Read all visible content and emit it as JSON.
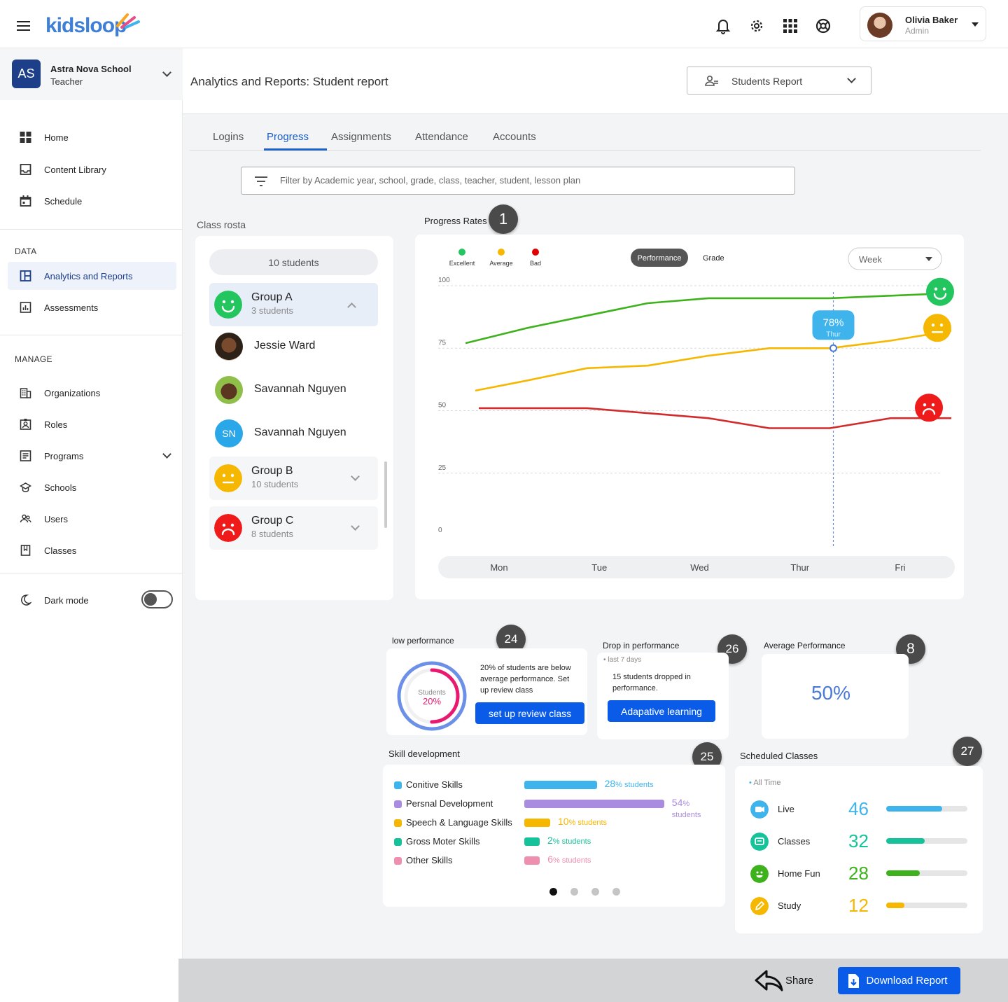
{
  "app": {
    "logo": "kidsloop"
  },
  "user": {
    "name": "Olivia Baker",
    "role": "Admin"
  },
  "school": {
    "initials": "AS",
    "name": "Astra Nova School",
    "role": "Teacher"
  },
  "sidebar": {
    "main_items": [
      {
        "label": "Home",
        "icon": "grid-icon"
      },
      {
        "label": "Content Library",
        "icon": "inbox-icon"
      },
      {
        "label": "Schedule",
        "icon": "calendar-icon"
      }
    ],
    "data_title": "DATA",
    "data_items": [
      {
        "label": "Analytics and Reports",
        "icon": "analytics-icon"
      },
      {
        "label": "Assessments",
        "icon": "bar-chart-icon"
      }
    ],
    "manage_title": "MANAGE",
    "manage_items": [
      {
        "label": "Organizations",
        "icon": "building-icon"
      },
      {
        "label": "Roles",
        "icon": "id-badge-icon"
      },
      {
        "label": "Programs",
        "icon": "list-icon"
      },
      {
        "label": "Schools",
        "icon": "school-icon"
      },
      {
        "label": "Users",
        "icon": "users-icon"
      },
      {
        "label": "Classes",
        "icon": "book-icon"
      }
    ],
    "dark_mode": "Dark mode"
  },
  "header": {
    "title": "Analytics and Reports: Student report",
    "report_select": "Students Report"
  },
  "tabs": [
    "Logins",
    "Progress",
    "Assignments",
    "Attendance",
    "Accounts"
  ],
  "filter_placeholder": "Filter by Academic year, school, grade, class, teacher, student, lesson plan",
  "roster": {
    "title": "Class rosta",
    "count": "10 students",
    "groups": [
      {
        "name": "Group A",
        "count": "3 students",
        "mood": "happy",
        "color": "#22c55e"
      },
      {
        "name": "Group B",
        "count": "10 students",
        "mood": "neutral",
        "color": "#f5b700"
      },
      {
        "name": "Group C",
        "count": "8 students",
        "mood": "sad",
        "color": "#ef1b1b"
      }
    ],
    "students": [
      {
        "name": "Jessie Ward"
      },
      {
        "name": "Savannah Nguyen"
      },
      {
        "name": "Savannah Nguyen",
        "initials": "SN"
      }
    ]
  },
  "progress": {
    "title": "Progress Rates",
    "badge": "1",
    "legend": [
      {
        "label": "Excellent",
        "color": "#22c55e"
      },
      {
        "label": "Average",
        "color": "#f5b700"
      },
      {
        "label": "Bad",
        "color": "#e00000"
      }
    ],
    "toggle": [
      "Performance",
      "Grade"
    ],
    "period": "Week",
    "tooltip": {
      "value": "78%",
      "label": "Thur"
    }
  },
  "chart_data": {
    "type": "line",
    "categories": [
      "Mon",
      "Tue",
      "Wed",
      "Thur",
      "Fri"
    ],
    "y_ticks": [
      "100",
      "75",
      "50",
      "25",
      "0"
    ],
    "ylim": [
      0,
      100
    ],
    "x_points": [
      0,
      0.5,
      1,
      1.5,
      2,
      2.5,
      3,
      3.5,
      4
    ],
    "series": [
      {
        "values": [
          77,
          83,
          88,
          93,
          95,
          95,
          95,
          96,
          97
        ],
        "color": "#3db21c"
      },
      {
        "values": [
          58,
          62,
          67,
          68,
          72,
          75,
          75,
          78,
          82
        ],
        "color": "#f5b700"
      },
      {
        "values": [
          51,
          51,
          51,
          49,
          47,
          43,
          43,
          47,
          47
        ],
        "color": "#d12b2b"
      }
    ]
  },
  "low_performance": {
    "title": "low performance",
    "badge": "24",
    "ring_label": "Students",
    "ring_value": "20%",
    "ring_fraction": 0.2,
    "text": "20% of students are below average performance. Set up review class",
    "button": "set up review class"
  },
  "drop": {
    "title": "Drop in performance",
    "badge": "26",
    "period": "last 7 days",
    "text": "15 students  dropped in performance.",
    "button": "Adapative learning"
  },
  "average": {
    "title": "Average Performance",
    "badge": "8",
    "value": "50%"
  },
  "skills": {
    "title": "Skill development",
    "badge": "25",
    "items": [
      {
        "name": "Conitive Skills",
        "value": "28",
        "unit": "% students",
        "fraction": 0.28,
        "color": "#3fb4ec"
      },
      {
        "name": "Persnal Development",
        "value": "54",
        "unit": "% students",
        "fraction": 0.54,
        "color": "#a98be0"
      },
      {
        "name": "Speech & Language Skills",
        "value": "10",
        "unit": "% students",
        "fraction": 0.1,
        "color": "#f5b700"
      },
      {
        "name": "Gross Moter Skills",
        "value": "2",
        "unit": "% students",
        "fraction": 0.02,
        "color": "#16c29a"
      },
      {
        "name": "Other Skills",
        "value": "6",
        "unit": "% students",
        "fraction": 0.06,
        "color": "#ee8faf"
      }
    ],
    "page_dots": 4,
    "active_dot": 0
  },
  "scheduled": {
    "title": "Scheduled Classes",
    "badge": "27",
    "period": "All Time",
    "items": [
      {
        "name": "Live",
        "value": "46",
        "fraction": 0.69,
        "color": "#3fb4ec",
        "icon": "video-icon"
      },
      {
        "name": "Classes",
        "value": "32",
        "fraction": 0.47,
        "color": "#16c29a",
        "icon": "chat-icon"
      },
      {
        "name": "Home Fun",
        "value": "28",
        "fraction": 0.41,
        "color": "#3db21c",
        "icon": "smile-icon"
      },
      {
        "name": "Study",
        "value": "12",
        "fraction": 0.22,
        "color": "#f5b700",
        "icon": "pencil-icon"
      }
    ]
  },
  "footer": {
    "share": "Share",
    "download": "Download Report"
  }
}
